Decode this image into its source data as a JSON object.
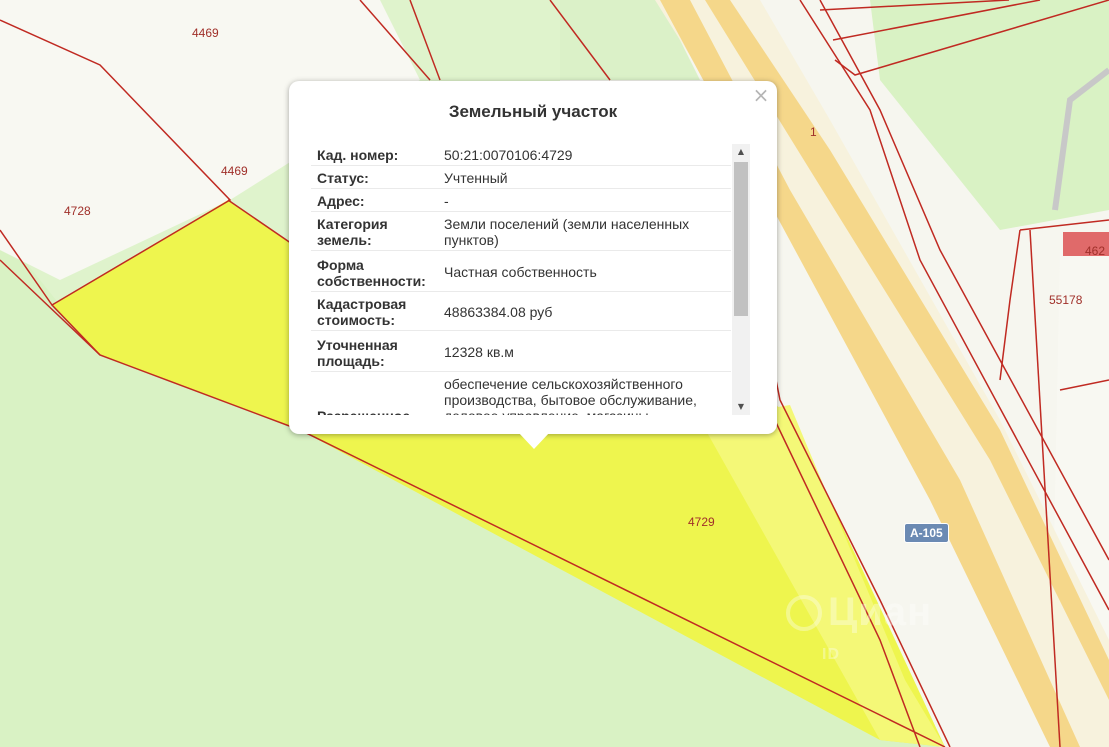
{
  "map": {
    "parcel_labels": [
      "4469",
      "4469",
      "4728",
      "4729",
      "1",
      "55178",
      "462"
    ],
    "highway": "A-105",
    "watermark": {
      "brand": "Циан",
      "sub": "ID"
    },
    "colors": {
      "field": "#d9f2c4",
      "selected_parcel": "#eef54e",
      "boundary": "#c02a22",
      "road": "#f5d78a"
    }
  },
  "popup": {
    "title": "Земельный участок",
    "close_icon": "×",
    "rows": [
      {
        "key": "Кад. номер:",
        "value": "50:21:0070106:4729"
      },
      {
        "key": "Статус:",
        "value": "Учтенный"
      },
      {
        "key": "Адрес:",
        "value": "-"
      },
      {
        "key": "Категория земель:",
        "value": "Земли поселений (земли населенных пунктов)"
      },
      {
        "key": "Форма собственности:",
        "value": "Частная собственность"
      },
      {
        "key": "Кадастровая стоимость:",
        "value": "48863384.08 руб"
      },
      {
        "key": "Уточненная площадь:",
        "value": "12328 кв.м"
      },
      {
        "key": "Разрешенное",
        "value": "обеспечение сельскохозяйственного производства, бытовое обслуживание, деловое управление, магазины"
      }
    ],
    "scroll_up_icon": "▲",
    "scroll_down_icon": "▼"
  }
}
